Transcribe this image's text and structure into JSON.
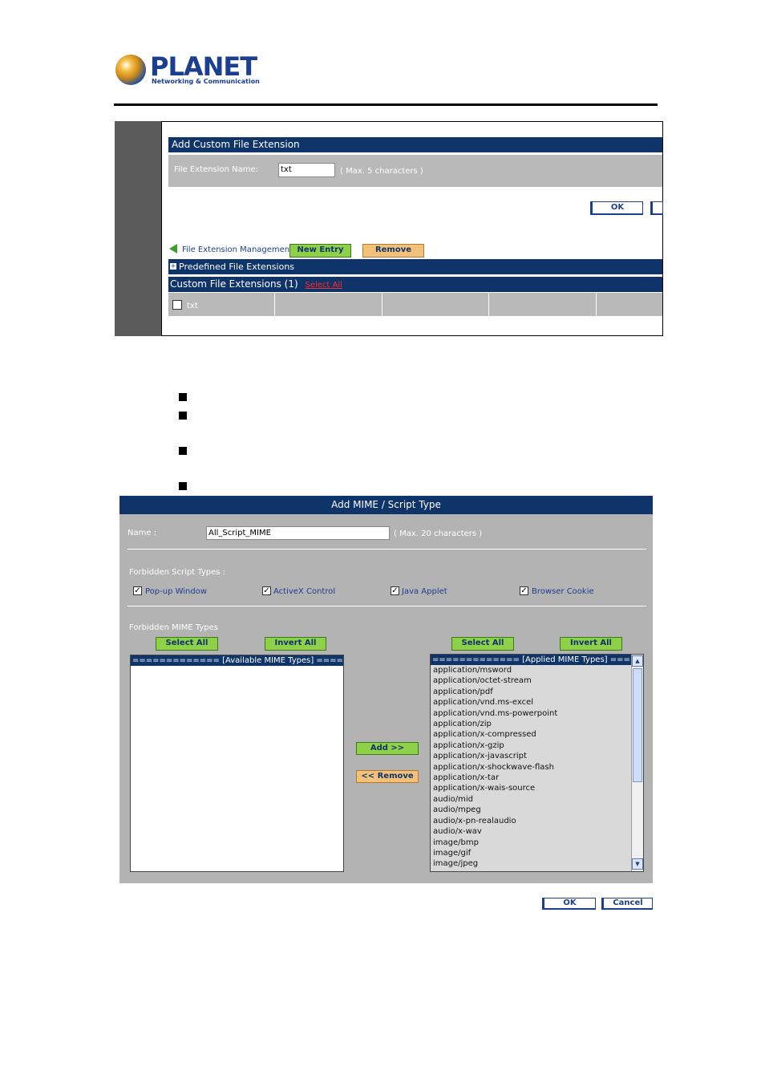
{
  "logo": {
    "name": "PLANET",
    "tagline": "Networking & Communication"
  },
  "ext_form": {
    "title": "Add Custom File Extension",
    "name_label": "File Extension Name:",
    "name_value": "txt",
    "name_hint": "( Max. 5 characters )",
    "ok_label": "OK",
    "mgmt_label": "File Extension Management :",
    "new_entry_label": "New Entry",
    "remove_label": "Remove",
    "predefined_label": "Predefined File Extensions",
    "custom_label": "Custom File Extensions (1)",
    "select_all_label": "Select All",
    "custom_items": [
      "txt"
    ]
  },
  "mime_form": {
    "title": "Add MIME / Script Type",
    "name_label": "Name :",
    "name_value": "All_Script_MIME",
    "name_hint": "( Max. 20 characters )",
    "script_types_label": "Forbidden Script Types :",
    "script_types": [
      {
        "label": "Pop-up Window",
        "checked": true
      },
      {
        "label": "ActiveX Control",
        "checked": true
      },
      {
        "label": "Java Applet",
        "checked": true
      },
      {
        "label": "Browser Cookie",
        "checked": true
      }
    ],
    "mime_types_label": "Forbidden MIME Types",
    "select_all_label": "Select All",
    "invert_all_label": "Invert All",
    "available_header": "============= [Available MIME Types] =============",
    "applied_header": "============= [Applied MIME Types] =============",
    "add_label": "Add >>",
    "remove_label": "<< Remove",
    "applied_items": [
      "application/msword",
      "application/octet-stream",
      "application/pdf",
      "application/vnd.ms-excel",
      "application/vnd.ms-powerpoint",
      "application/zip",
      "application/x-compressed",
      "application/x-gzip",
      "application/x-javascript",
      "application/x-shockwave-flash",
      "application/x-tar",
      "application/x-wais-source",
      "audio/mid",
      "audio/mpeg",
      "audio/x-pn-realaudio",
      "audio/x-wav",
      "image/bmp",
      "image/gif",
      "image/jpeg"
    ],
    "ok_label": "OK",
    "cancel_label": "Cancel"
  }
}
